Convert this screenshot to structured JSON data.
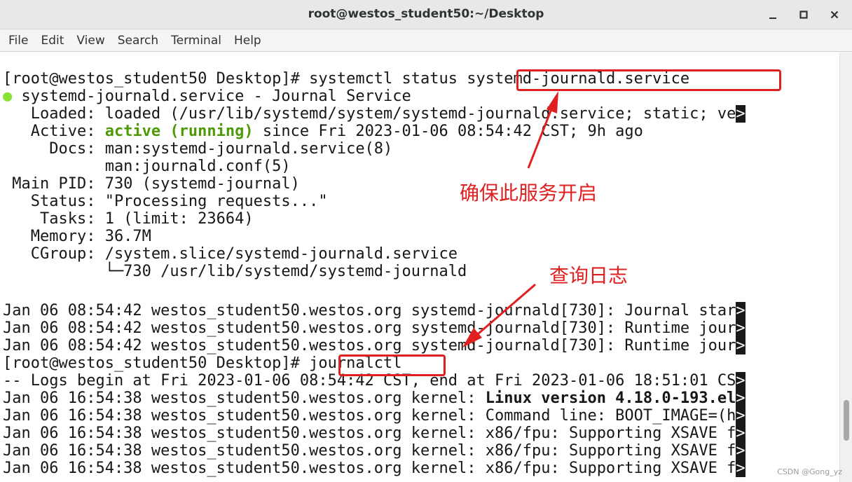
{
  "window": {
    "title": "root@westos_student50:~/Desktop"
  },
  "menu": [
    "File",
    "Edit",
    "View",
    "Search",
    "Terminal",
    "Help"
  ],
  "terminal": {
    "prompt1": "[root@westos_student50 Desktop]# ",
    "cmd1": "systemctl status systemd-journald.service",
    "status_dot": "●",
    "status_title": " systemd-journald.service - Journal Service",
    "loaded": "   Loaded: loaded (/usr/lib/systemd/system/systemd-journald.service; static; ve",
    "active_label": "   Active: ",
    "active_value": "active (running)",
    "active_rest": " since Fri 2023-01-06 08:54:42 CST; 9h ago",
    "docs1": "     Docs: man:systemd-journald.service(8)",
    "docs2": "           man:journald.conf(5)",
    "mainpid": " Main PID: 730 (systemd-journal)",
    "status": "   Status: \"Processing requests...\"",
    "tasks": "    Tasks: 1 (limit: 23664)",
    "memory": "   Memory: 36.7M",
    "cgroup": "   CGroup: /system.slice/systemd-journald.service",
    "cgroup_child": "           └─730 /usr/lib/systemd/systemd-journald",
    "log1": "Jan 06 08:54:42 westos_student50.westos.org systemd-journald[730]: Journal star",
    "log2": "Jan 06 08:54:42 westos_student50.westos.org systemd-journald[730]: Runtime jour",
    "log3": "Jan 06 08:54:42 westos_student50.westos.org systemd-journald[730]: Runtime jour",
    "prompt2": "[root@westos_student50 Desktop]# ",
    "cmd2": "journalctl",
    "logs_begin": "-- Logs begin at Fri 2023-01-06 08:54:42 CST, end at Fri 2023-01-06 18:51:01 CS",
    "k1_prefix": "Jan 06 16:54:38 westos_student50.westos.org kernel: ",
    "k1_bold": "Linux version 4.18.0-193.el",
    "k2": "Jan 06 16:54:38 westos_student50.westos.org kernel: Command line: BOOT_IMAGE=(h",
    "k3": "Jan 06 16:54:38 westos_student50.westos.org kernel: x86/fpu: Supporting XSAVE f",
    "k4": "Jan 06 16:54:38 westos_student50.westos.org kernel: x86/fpu: Supporting XSAVE f",
    "k5": "Jan 06 16:54:38 westos_student50.westos.org kernel: x86/fpu: Supporting XSAVE f",
    "trunc_marker": ">"
  },
  "annotations": {
    "note1": "确保此服务开启",
    "note2": "查询日志",
    "color": "#e02020"
  },
  "watermark": "CSDN @Gong_yz"
}
